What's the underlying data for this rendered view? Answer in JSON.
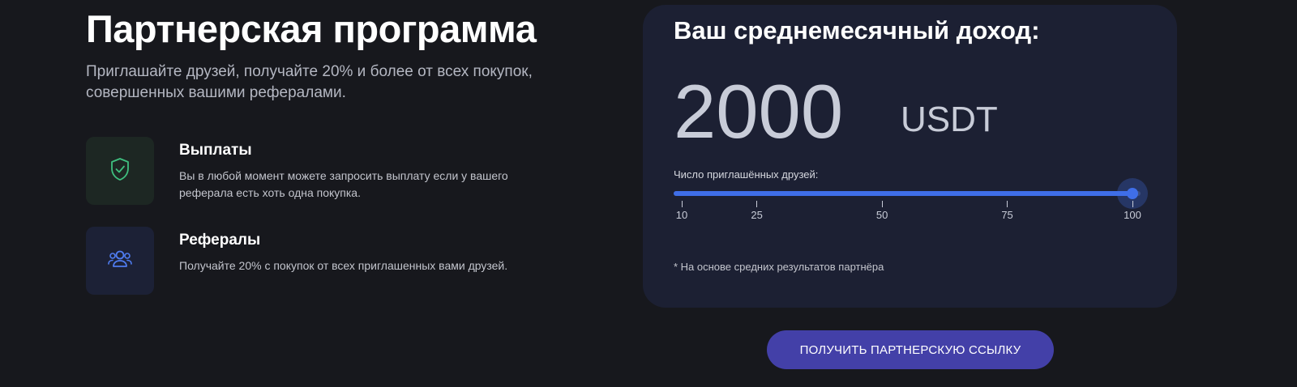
{
  "header": {
    "title": "Партнерская программа",
    "subtitle": "Приглашайте друзей, получайте 20% и более от всех покупок, совершенных вашими рефералами."
  },
  "features": [
    {
      "icon": "shield-check-icon",
      "title": "Выплаты",
      "text": "Вы в любой момент можете запросить выплату если у вашего реферала есть хоть одна покупка."
    },
    {
      "icon": "users-icon",
      "title": "Рефералы",
      "text": "Получайте 20% с покупок от всех приглашенных вами друзей."
    }
  ],
  "calculator": {
    "title": "Ваш среднемесячный доход:",
    "amount": "2000",
    "currency": "USDT",
    "slider_label": "Число приглашённых друзей:",
    "slider_min": 10,
    "slider_max": 100,
    "slider_value": 100,
    "ticks": [
      "10",
      "25",
      "50",
      "75",
      "100"
    ],
    "footnote": "* На основе средних результатов партнёра"
  },
  "cta": {
    "label": "ПОЛУЧИТЬ ПАРТНЕРСКУЮ ССЫЛКУ"
  },
  "colors": {
    "background": "#17181d",
    "card": "#1c2033",
    "accent": "#3f6ee8",
    "button": "#4340a8",
    "success_icon": "#3fbf7f"
  }
}
